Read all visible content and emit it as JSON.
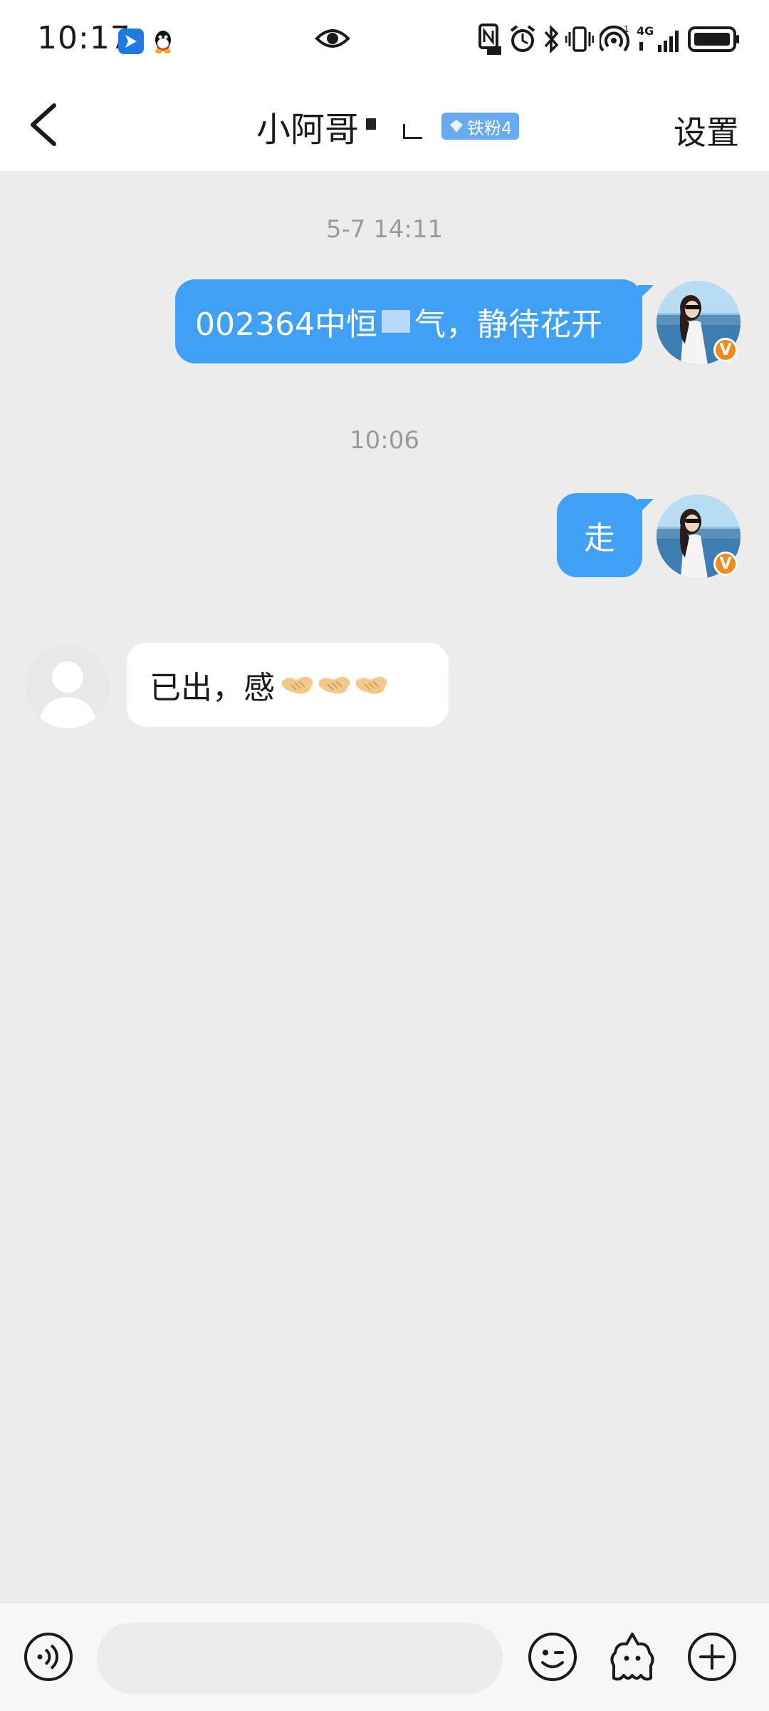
{
  "status_bar": {
    "time": "10:17",
    "network_label": "4G",
    "sim_slot": "1"
  },
  "header": {
    "title": "小阿哥",
    "badge_label": "铁粉4",
    "settings_label": "设置"
  },
  "messages": [
    {
      "type": "time",
      "text": "5-7 14:11"
    },
    {
      "type": "outgoing",
      "text_before": "002364中恒",
      "text_after": "气，静待花开"
    },
    {
      "type": "time",
      "text": "10:06"
    },
    {
      "type": "outgoing",
      "text": "走"
    },
    {
      "type": "incoming",
      "text": "已出，感",
      "emoji_count": 3
    }
  ],
  "composer": {
    "input_value": "",
    "placeholder": ""
  },
  "colors": {
    "outgoing_bubble": "#3fa0f5",
    "incoming_bubble": "#ffffff",
    "chat_background": "#ececec",
    "badge": "#68aaf0",
    "verified_badge": "#f08a1c"
  },
  "icons": {
    "back": "chevron-left-icon",
    "voice": "voice-icon",
    "emoji": "smiley-icon",
    "sticker": "sticker-icon",
    "add": "plus-icon",
    "verified": "verified-icon"
  }
}
